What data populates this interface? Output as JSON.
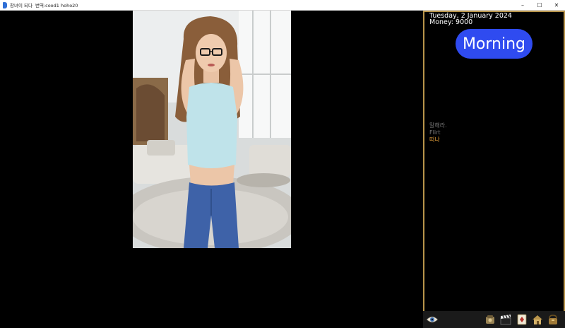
{
  "window": {
    "title": "창녀이 되다",
    "subtitle": "번역:cood1 hoho20",
    "minimize": "–",
    "maximize": "☐",
    "close": "✕"
  },
  "status": {
    "date": "Tuesday, 2 January 2024",
    "money": "Money: 9000",
    "time_of_day": "Morning",
    "time_color": "#2f4bf0"
  },
  "menu": {
    "items": [
      {
        "label": "말해라.",
        "state": "dim"
      },
      {
        "label": "Flirt",
        "state": "dim"
      },
      {
        "label": "떠나",
        "state": "active"
      }
    ]
  },
  "toolbar": {
    "icons": [
      "eye-icon",
      "phone-icon",
      "clapper-icon",
      "card-icon",
      "house-icon",
      "bag-icon"
    ]
  },
  "colors": {
    "panel_border": "#b8944a",
    "active_option": "#e8a33d",
    "dim_option": "#7a7a7a"
  }
}
